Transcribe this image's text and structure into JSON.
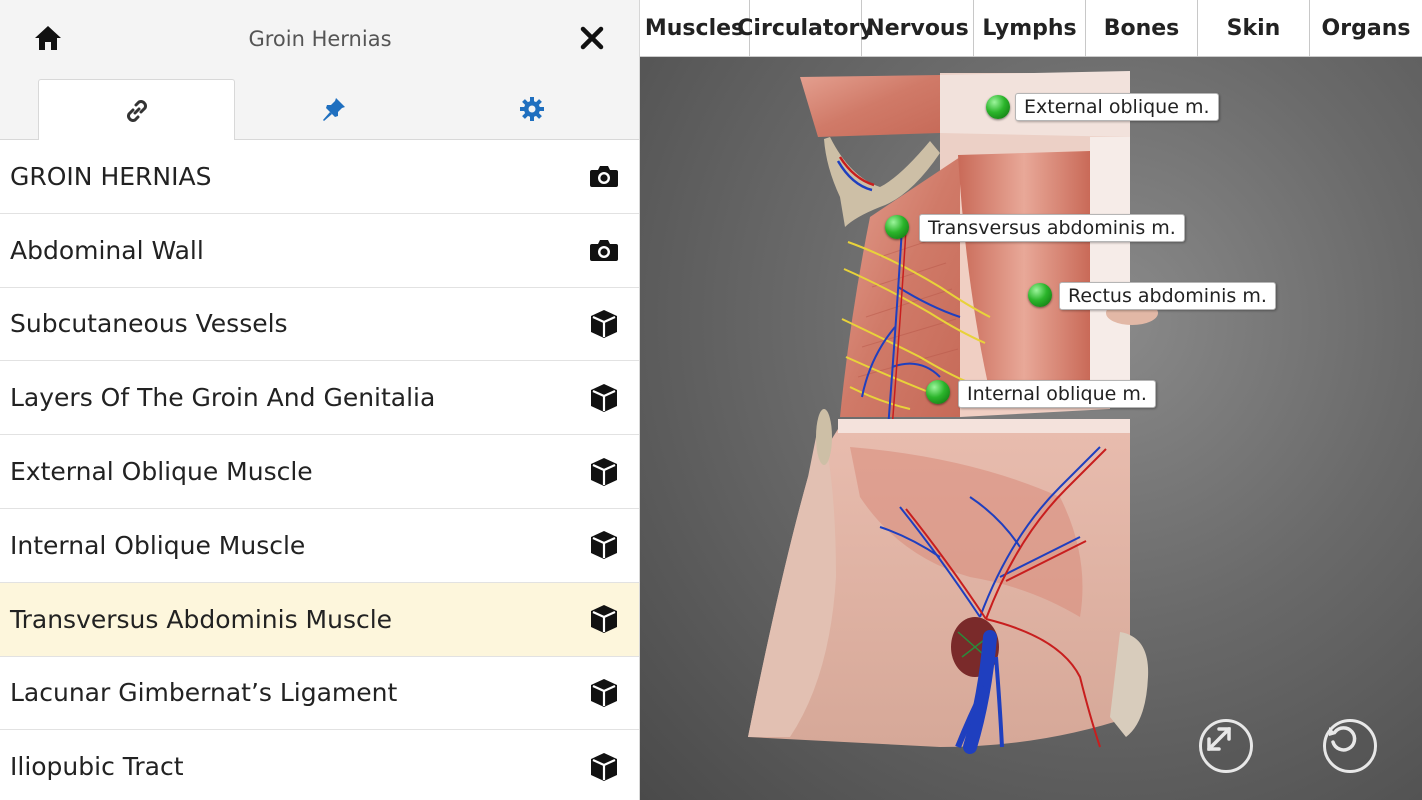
{
  "header": {
    "title": "Groin Hernias",
    "home_icon": "home-icon",
    "close_icon": "close-icon"
  },
  "tabs": [
    {
      "name": "links",
      "icon": "link-icon",
      "active": true
    },
    {
      "name": "pins",
      "icon": "pushpin-icon",
      "active": false
    },
    {
      "name": "settings",
      "icon": "gear-icon",
      "active": false
    }
  ],
  "list": {
    "items": [
      {
        "label": "GROIN HERNIAS",
        "icon": "camera-icon",
        "selected": false
      },
      {
        "label": "Abdominal Wall",
        "icon": "camera-icon",
        "selected": false
      },
      {
        "label": "Subcutaneous Vessels",
        "icon": "cube-icon",
        "selected": false
      },
      {
        "label": "Layers Of The Groin And Genitalia",
        "icon": "cube-icon",
        "selected": false
      },
      {
        "label": "External Oblique Muscle",
        "icon": "cube-icon",
        "selected": false
      },
      {
        "label": "Internal Oblique Muscle",
        "icon": "cube-icon",
        "selected": false
      },
      {
        "label": "Transversus Abdominis Muscle",
        "icon": "cube-icon",
        "selected": true
      },
      {
        "label": "Lacunar Gimbernat’s Ligament",
        "icon": "cube-icon",
        "selected": false
      },
      {
        "label": "Iliopubic Tract",
        "icon": "cube-icon",
        "selected": false
      }
    ]
  },
  "topbar": {
    "systems": [
      "Muscles",
      "Circulatory",
      "Nervous",
      "Lymphs",
      "Bones",
      "Skin",
      "Organs"
    ]
  },
  "annotations": {
    "external_oblique": "External oblique m.",
    "transversus": "Transversus abdominis m.",
    "rectus": "Rectus abdominis m.",
    "internal_oblique": "Internal oblique m."
  },
  "controls": {
    "expand_icon": "expand-icon",
    "reset_icon": "reset-rotate-icon"
  },
  "colors": {
    "selected_row": "#fdf6dc",
    "tab_icon": "#1f6fbf",
    "pin_green": "#2bb52b",
    "artery": "#c81e1e",
    "vein": "#1f3fbf",
    "nerve": "#e8d23a",
    "muscle": "#d98a7a"
  }
}
